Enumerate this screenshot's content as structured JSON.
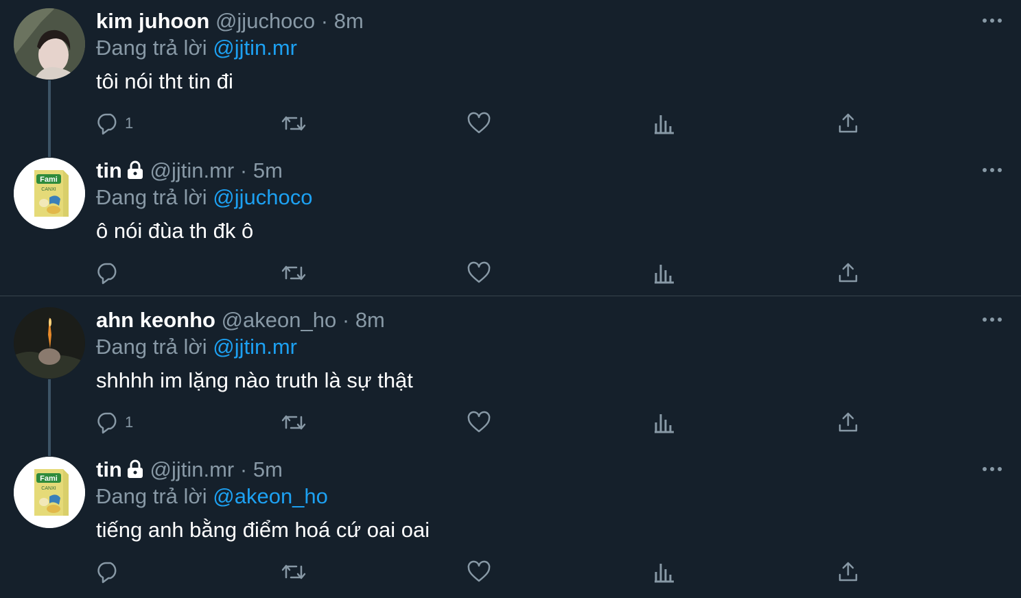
{
  "tweets": [
    {
      "name": "kim juhoon",
      "handle": "@jjuchoco",
      "dot": "·",
      "time": "8m",
      "locked": false,
      "reply_label": "Đang trả lời",
      "reply_to": "@jjtin.mr",
      "text": "tôi nói tht tin đi",
      "reply_count": "1"
    },
    {
      "name": "tin",
      "handle": "@jjtin.mr",
      "dot": "·",
      "time": "5m",
      "locked": true,
      "reply_label": "Đang trả lời",
      "reply_to": "@jjuchoco",
      "text": "ô nói đùa th đk ô",
      "reply_count": ""
    },
    {
      "name": "ahn keonho",
      "handle": "@akeon_ho",
      "dot": "·",
      "time": "8m",
      "locked": false,
      "reply_label": "Đang trả lời",
      "reply_to": "@jjtin.mr",
      "text": "shhhh im lặng nào truth là sự thật",
      "reply_count": "1"
    },
    {
      "name": "tin",
      "handle": "@jjtin.mr",
      "dot": "·",
      "time": "5m",
      "locked": true,
      "reply_label": "Đang trả lời",
      "reply_to": "@akeon_ho",
      "text": "tiếng anh bằng điểm hoá cứ oai oai",
      "reply_count": ""
    }
  ],
  "avatar_logo_text": "Fami",
  "avatar_logo_subtext": "CANXI",
  "icons": [
    "reply-icon",
    "retweet-icon",
    "like-icon",
    "analytics-icon",
    "share-icon",
    "more-icon",
    "lock-icon"
  ],
  "colors": {
    "background": "#15202b",
    "text": "#ffffff",
    "secondary": "#8899a6",
    "link": "#1da1f2",
    "divider": "#38444d"
  }
}
